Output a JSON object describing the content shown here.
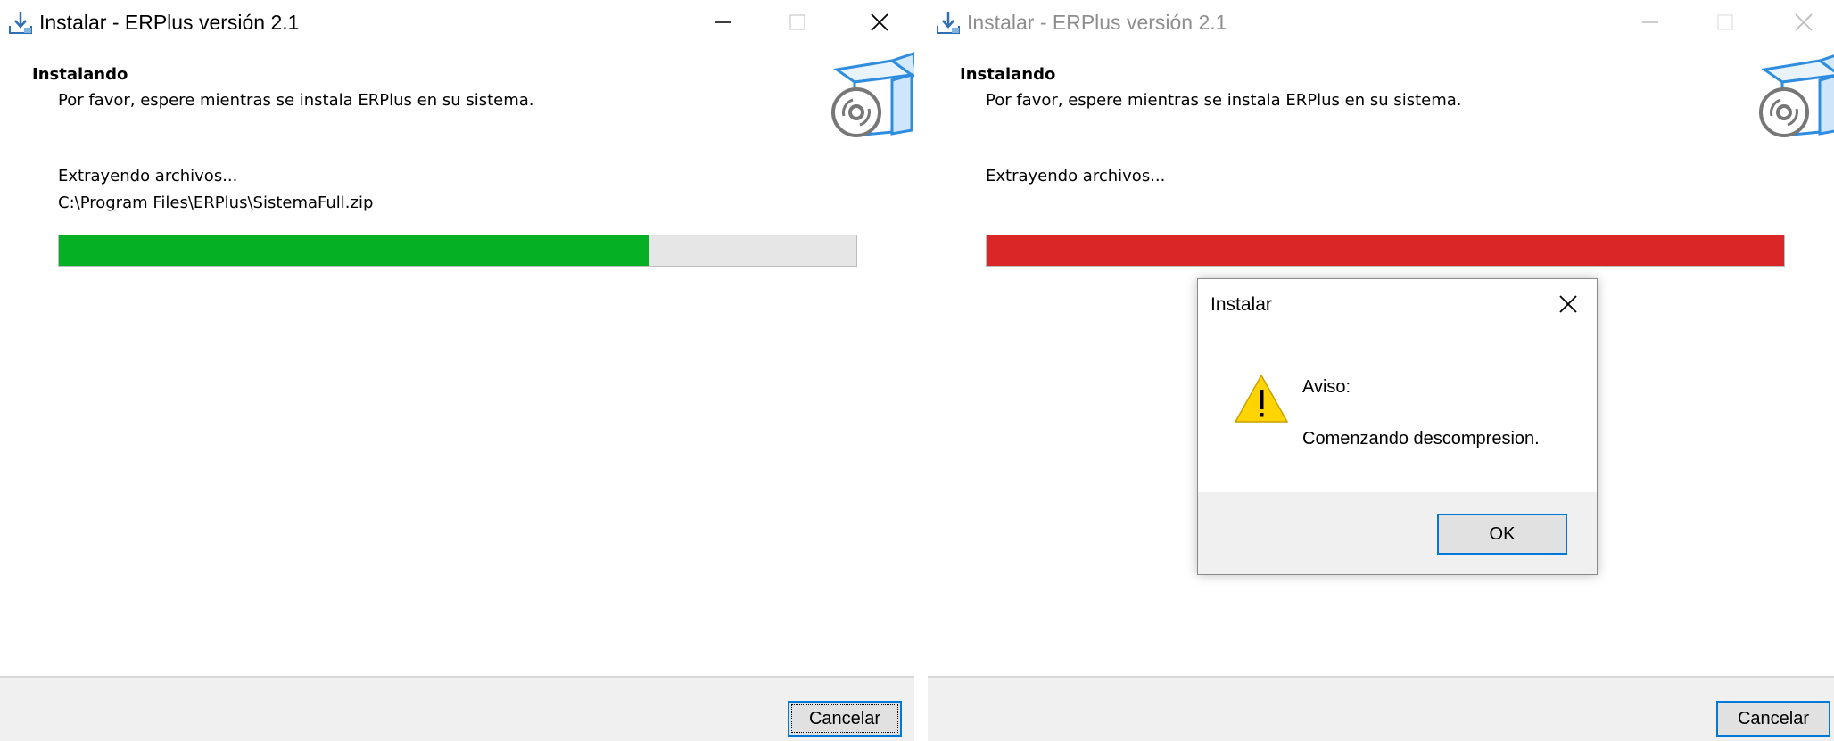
{
  "left_window": {
    "title": "Instalar - ERPlus versión 2.1",
    "heading": "Instalando",
    "subheading": "Por favor, espere mientras se instala ERPlus en su sistema.",
    "status": "Extrayendo archivos...",
    "filepath": "C:\\Program Files\\ERPlus\\SistemaFull.zip",
    "progress_fraction": 0.74,
    "progress_color": "#06b025",
    "cancel_label": "Cancelar"
  },
  "right_window": {
    "title": "Instalar - ERPlus versión 2.1",
    "heading": "Instalando",
    "subheading": "Por favor, espere mientras se instala ERPlus en su sistema.",
    "status": "Extrayendo archivos...",
    "progress_fraction": 1.0,
    "progress_color": "#da2626",
    "cancel_label": "Cancelar"
  },
  "dialog": {
    "title": "Instalar",
    "message_title": "Aviso:",
    "message_body": "Comenzando descompresion.",
    "ok_label": "OK",
    "icon": "warning-icon"
  },
  "icons": {
    "app": "install-download-icon",
    "setup": "software-box-disc-icon",
    "minimize": "minimize-icon",
    "maximize": "maximize-icon",
    "close": "close-icon"
  },
  "colors": {
    "accent": "#0078d7",
    "footer_bg": "#f0f0f0",
    "warning": "#ffd400"
  }
}
